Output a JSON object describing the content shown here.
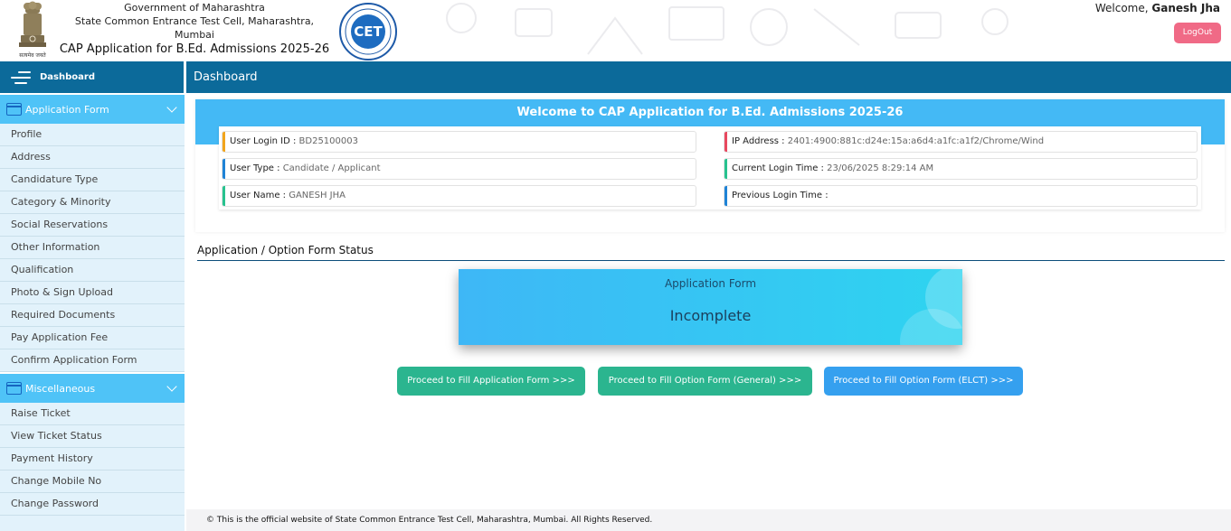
{
  "header": {
    "gov": "Government of Maharashtra",
    "cell": "State Common Entrance Test Cell, Maharashtra, Mumbai",
    "app_title": "CAP Application for B.Ed. Admissions 2025-26",
    "emblem_caption": "सत्यमेव जयते",
    "cet_logo_text": "CET",
    "welcome_prefix": "Welcome,",
    "user_name": "Ganesh Jha",
    "logout": "LogOut"
  },
  "sidebar": {
    "dashboard": "Dashboard",
    "sections": [
      {
        "title": "Application Form",
        "items": [
          "Profile",
          "Address",
          "Candidature Type",
          "Category & Minority",
          "Social Reservations",
          "Other Information",
          "Qualification",
          "Photo & Sign Upload",
          "Required Documents",
          "Pay Application Fee",
          "Confirm Application Form"
        ]
      },
      {
        "title": "Miscellaneous",
        "items": [
          "Raise Ticket",
          "View Ticket Status",
          "Payment History",
          "Change Mobile No",
          "Change Password"
        ]
      }
    ]
  },
  "main": {
    "bar_title": "Dashboard",
    "welcome_title": "Welcome to CAP Application for B.Ed. Admissions 2025-26",
    "fields": {
      "login_id": {
        "label": "User Login ID :",
        "value": "BD25100003"
      },
      "user_type": {
        "label": "User Type :",
        "value": "Candidate / Applicant"
      },
      "user_name": {
        "label": "User Name :",
        "value": "GANESH JHA"
      },
      "ip": {
        "label": "IP Address :",
        "value": "2401:4900:881c:d24e:15a:a6d4:a1fc:a1f2/Chrome/Wind"
      },
      "current_login": {
        "label": "Current Login Time :",
        "value": "23/06/2025 8:29:14 AM"
      },
      "previous_login": {
        "label": "Previous Login Time :",
        "value": ""
      }
    },
    "status_section_title": "Application / Option Form Status",
    "status_card": {
      "label": "Application Form",
      "value": "Incomplete"
    },
    "actions": {
      "fill_application": "Proceed to Fill Application Form >>>",
      "fill_option_general": "Proceed to Fill Option Form (General) >>>",
      "fill_option_elct": "Proceed to Fill Option Form (ELCT) >>>"
    }
  },
  "footer": "© This is the official website of State Common Entrance Test Cell, Maharashtra, Mumbai. All Rights Reserved.",
  "colors": {
    "primary": "#0c6a9a",
    "accent": "#44b9f5",
    "logout": "#f06a86",
    "green_button": "#2bb58f",
    "blue_button": "#35a0ef",
    "bar_orange": "#f2a51c",
    "bar_blue": "#1f83d6",
    "bar_green": "#27c28f",
    "bar_red": "#e8485f"
  }
}
